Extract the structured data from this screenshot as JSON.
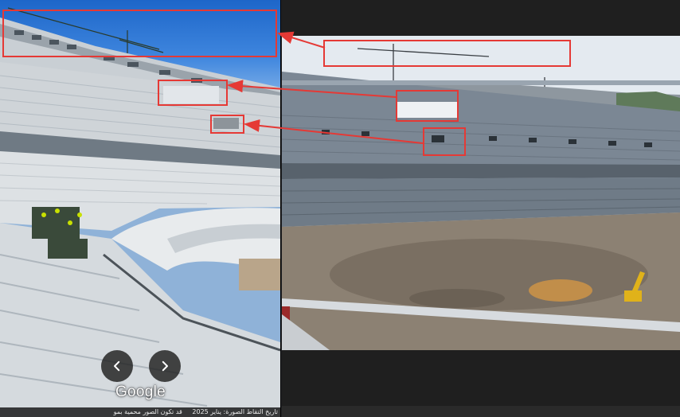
{
  "left_panel": {
    "provider_logo": "Google",
    "caption": {
      "date_text": "تاريخ التقاط الصورة: يناير 2025",
      "notice_text": "قد تكون الصور محمية بمو"
    },
    "nav": {
      "prev_icon": "chevron-left-icon",
      "next_icon": "chevron-right-icon"
    }
  },
  "annotations": {
    "color": "#e53935",
    "box_count": 6,
    "arrow_count": 3
  },
  "colors": {
    "sky": "#2f7bd8",
    "background": "#202124",
    "annotation_red": "#e53935"
  }
}
